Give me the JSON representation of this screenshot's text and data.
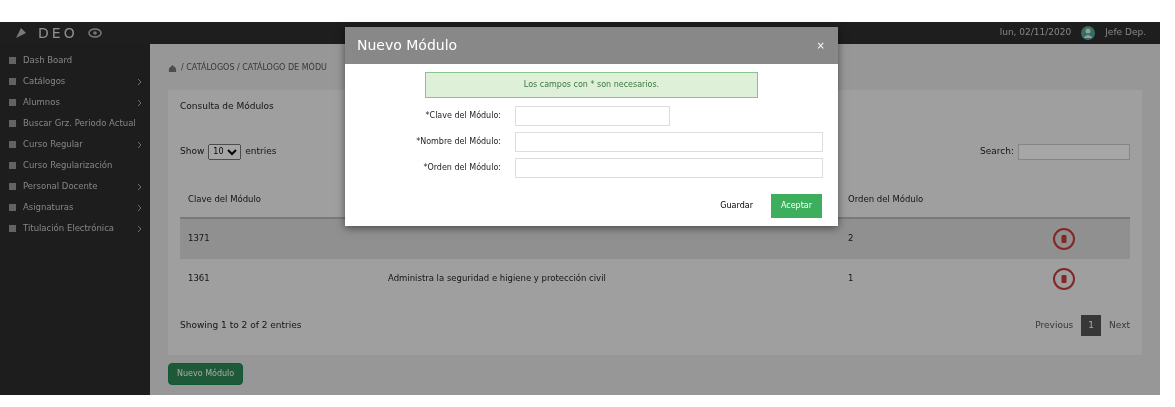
{
  "navbar": {
    "brand": "DEO",
    "date": "lun, 02/11/2020",
    "user": "Jefe Dep."
  },
  "sidebar": {
    "items": [
      {
        "label": "Dash Board",
        "expandable": false
      },
      {
        "label": "Catálogos",
        "expandable": true
      },
      {
        "label": "Alumnos",
        "expandable": true
      },
      {
        "label": "Buscar Grz. Periodo Actual",
        "expandable": false
      },
      {
        "label": "Curso Regular",
        "expandable": true
      },
      {
        "label": "Curso Regularización",
        "expandable": false
      },
      {
        "label": "Personal Docente",
        "expandable": true
      },
      {
        "label": "Asignaturas",
        "expandable": true
      },
      {
        "label": "Titulación Electrónica",
        "expandable": true
      }
    ]
  },
  "breadcrumb": "/ CATÁLOGOS / CATÁLOGO DE MÓDU",
  "panel": {
    "title": "Consulta de Módulos",
    "length_menu": {
      "prefix": "Show",
      "value": "10",
      "suffix": "entries"
    },
    "search_label": "Search:",
    "table": {
      "columns": [
        "Clave del Módulo",
        "Orden del Módulo"
      ],
      "rows": [
        {
          "clave": "1371",
          "orden": "2"
        },
        {
          "clave": "1361",
          "nombre": "Administra la seguridad e higiene y protección civil",
          "orden": "1"
        }
      ]
    },
    "info": "Showing 1 to 2 of 2 entries",
    "pagination": {
      "previous": "Previous",
      "pages": [
        {
          "label": "1",
          "selected": true
        }
      ],
      "next": "Next"
    }
  },
  "new_button": "Nuevo Módulo",
  "modal": {
    "title": "Nuevo Módulo",
    "close": "×",
    "alert": "Los campos con * son necesarios.",
    "fields": [
      {
        "label": "*Clave del Módulo:",
        "wide": false
      },
      {
        "label": "*Nombre del Módulo:",
        "wide": true
      },
      {
        "label": "*Orden del Módulo:",
        "wide": true
      }
    ],
    "buttons": [
      {
        "label": "Guardar",
        "kind": "secondary"
      },
      {
        "label": "Aceptar",
        "kind": "primary"
      }
    ]
  }
}
